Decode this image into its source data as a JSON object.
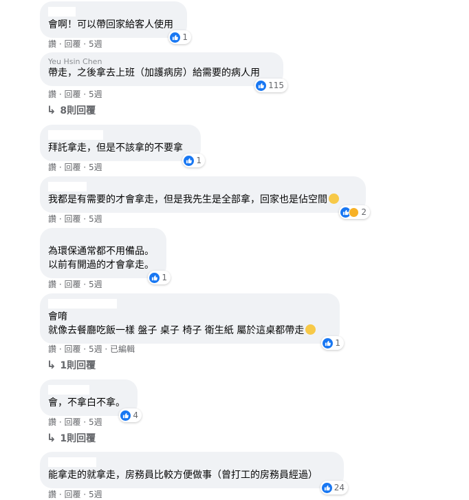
{
  "comments": [
    {
      "author_visible": "",
      "lines": [
        "會啊！可以帶回家給客人使用"
      ],
      "reaction_count": "1",
      "reactions": [
        "like"
      ],
      "meta": {
        "like": "讚",
        "reply": "回覆",
        "time": "5週"
      }
    },
    {
      "author_visible": "Yeu Hsin Chen",
      "lines": [
        "帶走，之後拿去上班（加護病房）給需要的病人用"
      ],
      "reaction_count": "115",
      "reactions": [
        "like"
      ],
      "meta": {
        "like": "讚",
        "reply": "回覆",
        "time": "5週"
      },
      "replies_link": "8則回覆"
    },
    {
      "author_visible": "",
      "lines": [
        "拜託拿走，但是不該拿的不要拿"
      ],
      "reaction_count": "1",
      "reactions": [
        "like"
      ],
      "meta": {
        "like": "讚",
        "reply": "回覆",
        "time": "5週"
      }
    },
    {
      "author_visible": "",
      "lines": [
        "我都是有需要的才會拿走，但是我先生是全部拿，回家也是佔空間"
      ],
      "reaction_count": "2",
      "reactions": [
        "like",
        "haha"
      ],
      "meta": {
        "like": "讚",
        "reply": "回覆",
        "time": "5週"
      }
    },
    {
      "author_visible": "",
      "lines": [
        "為環保通常都不用備品。",
        "以前有開過的才會拿走。"
      ],
      "reaction_count": "1",
      "reactions": [
        "like"
      ],
      "meta": {
        "like": "讚",
        "reply": "回覆",
        "time": "5週"
      }
    },
    {
      "author_visible": "",
      "lines": [
        "會唷",
        "就像去餐廳吃飯一樣 盤子 桌子 椅子 衛生紙 屬於這桌都帶走"
      ],
      "reaction_count": "1",
      "reactions": [
        "like"
      ],
      "meta": {
        "like": "讚",
        "reply": "回覆",
        "time": "5週",
        "edited": "已編輯"
      },
      "replies_link": "1則回覆"
    },
    {
      "author_visible": "",
      "lines": [
        "會，不拿白不拿。"
      ],
      "reaction_count": "4",
      "reactions": [
        "like"
      ],
      "meta": {
        "like": "讚",
        "reply": "回覆",
        "time": "5週"
      },
      "replies_link": "1則回覆"
    },
    {
      "author_visible": "",
      "lines": [
        "能拿走的就拿走，房務員比較方便做事（曾打工的房務員經過）"
      ],
      "reaction_count": "24",
      "reactions": [
        "like"
      ],
      "meta": {
        "like": "讚",
        "reply": "回覆",
        "time": "5週"
      }
    }
  ],
  "separator": "·",
  "colors": {
    "bubble": "#f0f2f5",
    "like": "#1877f2",
    "meta_text": "#65676b"
  }
}
